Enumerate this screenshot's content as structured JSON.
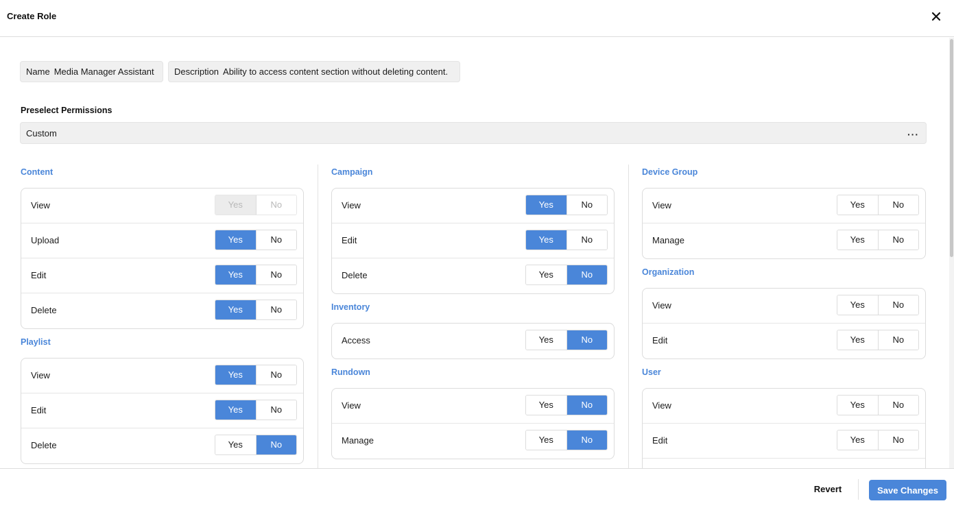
{
  "header": {
    "title": "Create Role"
  },
  "fields": {
    "name_label": "Name",
    "name_value": "Media Manager Assistant",
    "description_label": "Description",
    "description_value": "Ability to access content section without deleting content."
  },
  "preselect": {
    "label": "Preselect Permissions",
    "value": "Custom",
    "more": "···"
  },
  "toggle_labels": {
    "yes": "Yes",
    "no": "No"
  },
  "colors": {
    "accent": "#4a86d9"
  },
  "sections": [
    {
      "title": "Content",
      "rows": [
        {
          "label": "View",
          "value": "yes",
          "disabled": true
        },
        {
          "label": "Upload",
          "value": "yes"
        },
        {
          "label": "Edit",
          "value": "yes"
        },
        {
          "label": "Delete",
          "value": "yes"
        }
      ]
    },
    {
      "title": "Playlist",
      "rows": [
        {
          "label": "View",
          "value": "yes"
        },
        {
          "label": "Edit",
          "value": "yes"
        },
        {
          "label": "Delete",
          "value": "no"
        }
      ]
    },
    {
      "title": "Campaign",
      "rows": [
        {
          "label": "View",
          "value": "yes"
        },
        {
          "label": "Edit",
          "value": "yes"
        },
        {
          "label": "Delete",
          "value": "no"
        }
      ]
    },
    {
      "title": "Inventory",
      "rows": [
        {
          "label": "Access",
          "value": "no"
        }
      ]
    },
    {
      "title": "Rundown",
      "rows": [
        {
          "label": "View",
          "value": "no"
        },
        {
          "label": "Manage",
          "value": "no"
        }
      ]
    },
    {
      "title": "Device Group",
      "rows": [
        {
          "label": "View",
          "value": ""
        },
        {
          "label": "Manage",
          "value": ""
        }
      ]
    },
    {
      "title": "Organization",
      "rows": [
        {
          "label": "View",
          "value": ""
        },
        {
          "label": "Edit",
          "value": ""
        }
      ]
    },
    {
      "title": "User",
      "rows": [
        {
          "label": "View",
          "value": ""
        },
        {
          "label": "Edit",
          "value": ""
        },
        {
          "label": "",
          "value": ""
        }
      ]
    }
  ],
  "footer": {
    "revert": "Revert",
    "save": "Save Changes"
  }
}
